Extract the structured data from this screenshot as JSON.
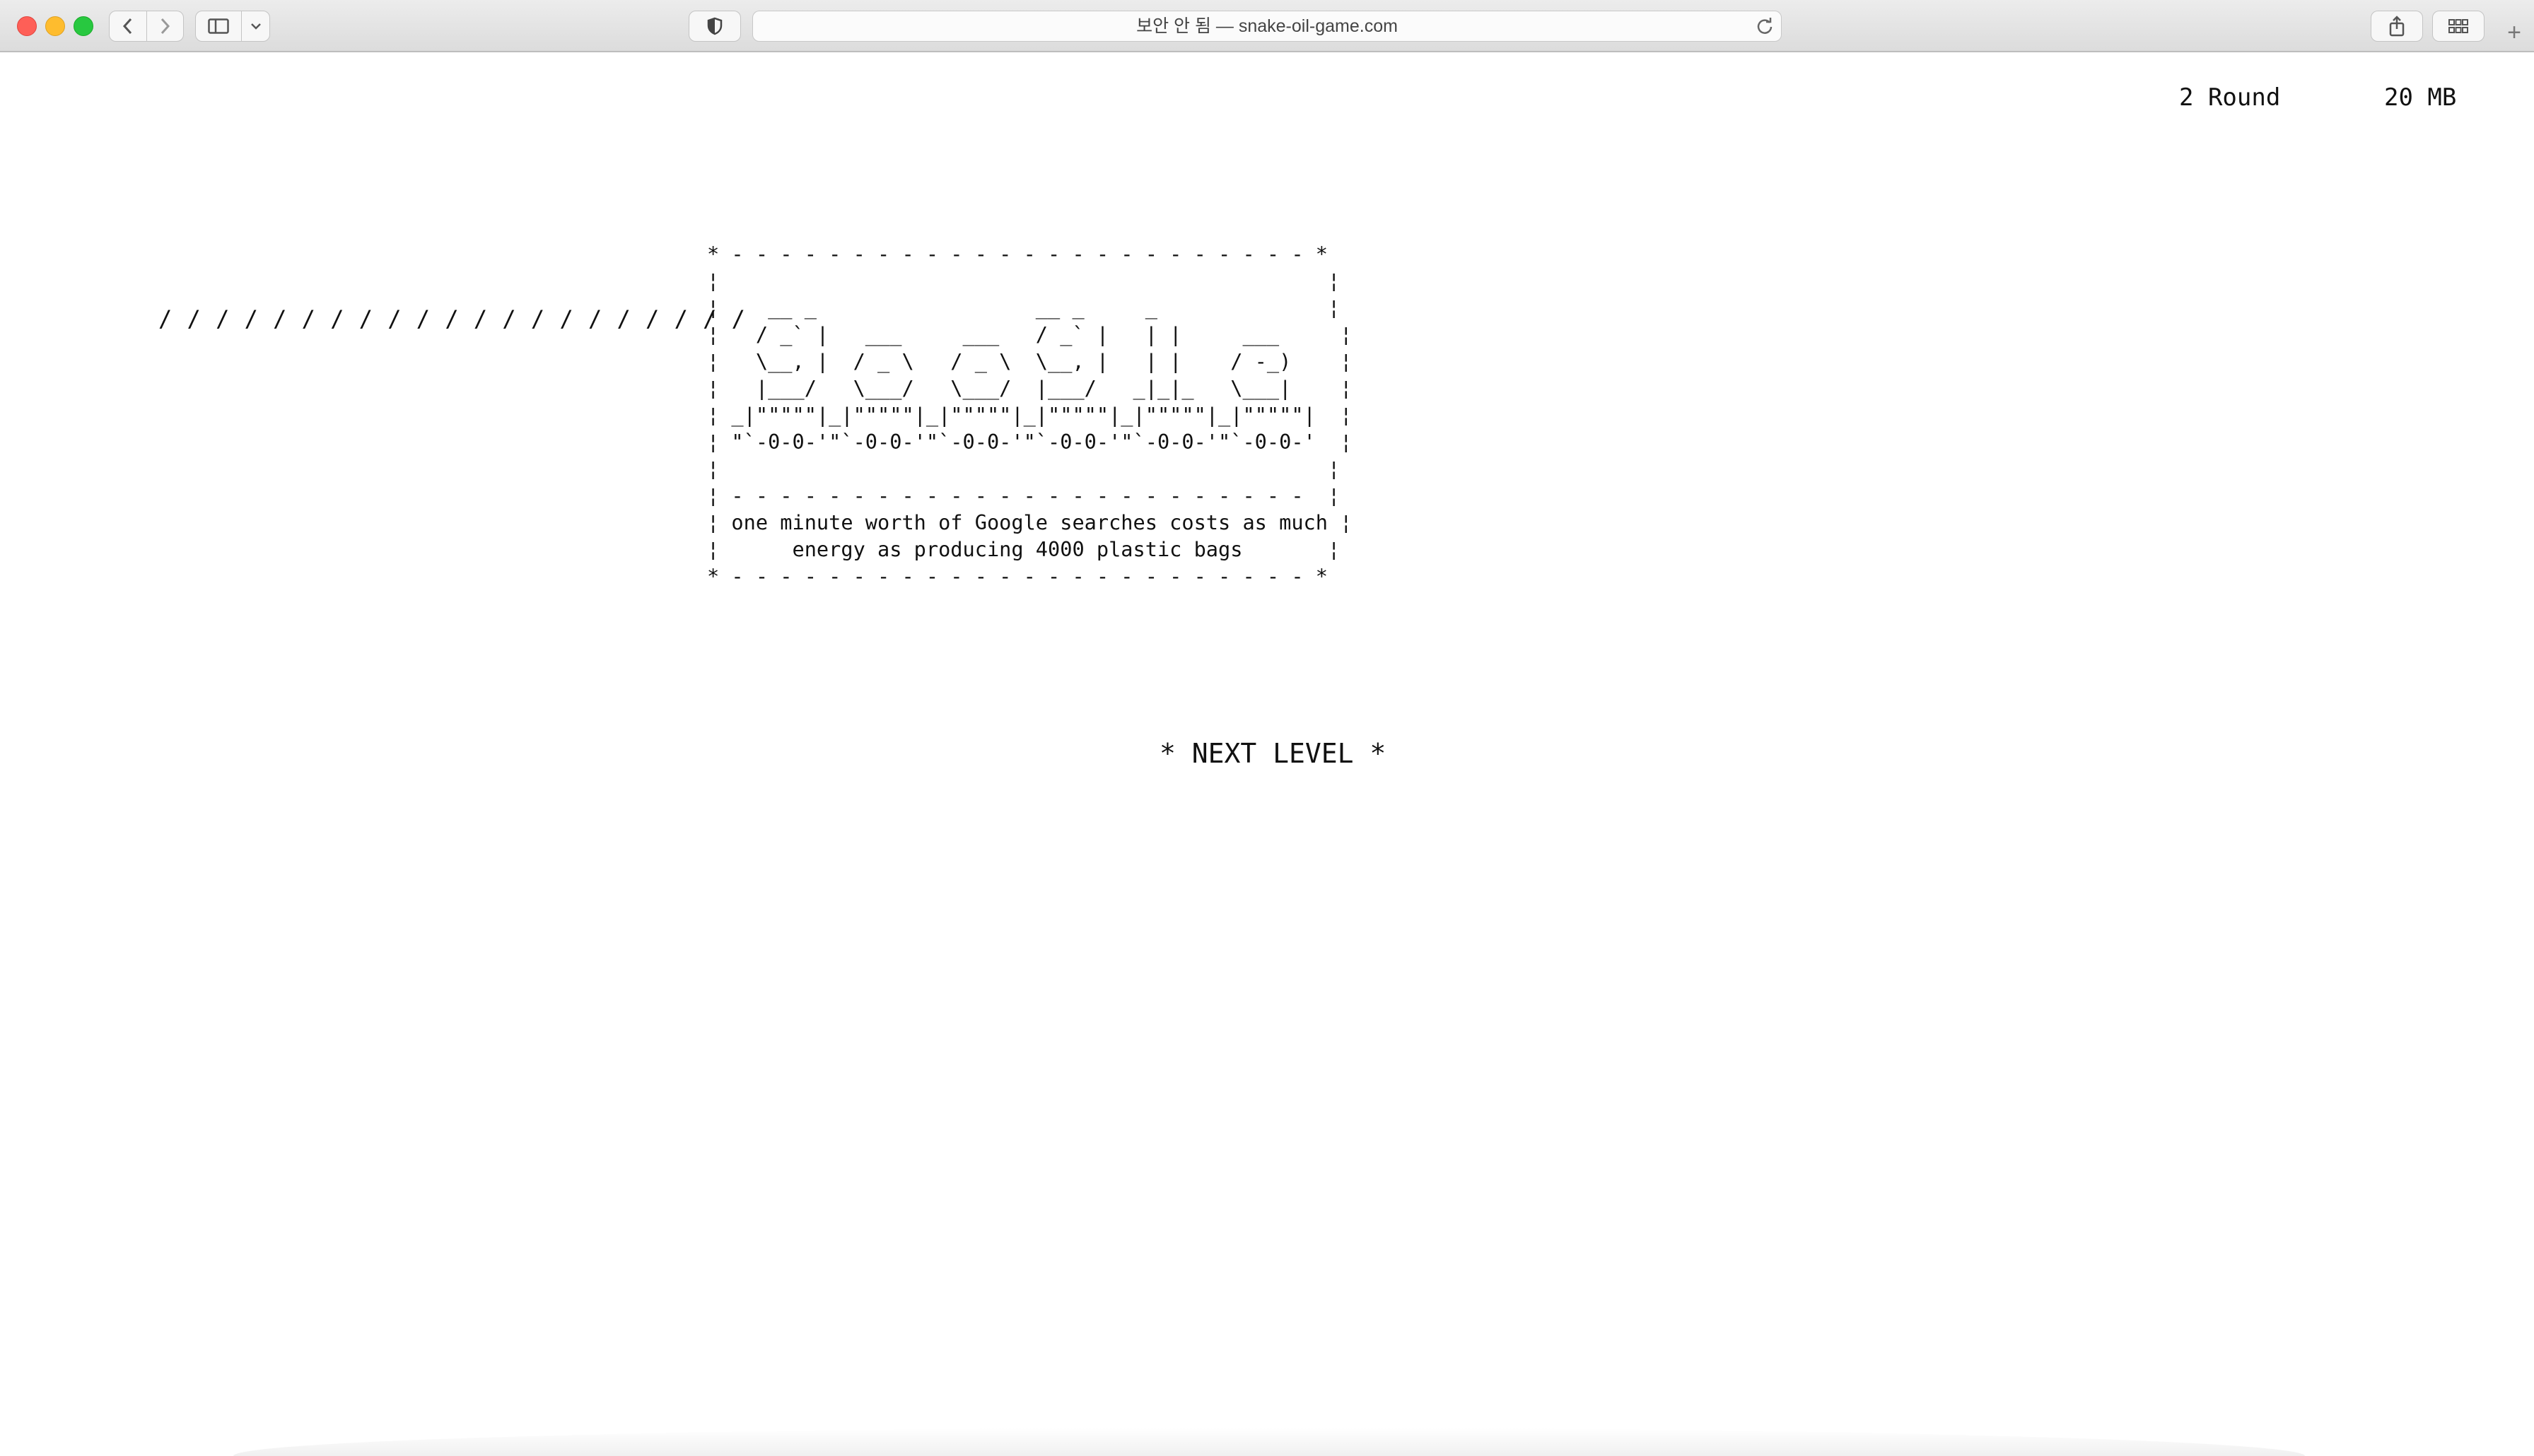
{
  "browser": {
    "url_display": "보안 안 됨 — snake-oil-game.com",
    "icons": {
      "back": "chevron-left-icon",
      "forward": "chevron-right-icon",
      "sidebar": "sidebar-icon",
      "sidebar_menu": "chevron-down-icon",
      "privacy": "shield-icon",
      "reload": "reload-icon",
      "share": "share-icon",
      "tabs": "tab-overview-icon",
      "new_tab": "plus-icon"
    },
    "new_tab_glyph": "+"
  },
  "game": {
    "round_label": "2 Round",
    "memory_label": "20 MB",
    "progress_slashes": "/ / / / / / / / / / / / / / / / / / / / /",
    "ascii_art": "* - - - - - - - - - - - - - - - - - - - - - - - - *\n¦                                                  ¦\n¦    __ _                  __ _     _              ¦\n¦   / _` |   ___     ___   / _` |   | |     ___     ¦\n¦   \\__, |  / _ \\   / _ \\  \\__, |   | |    / -_)    ¦\n¦   |___/   \\___/   \\___/  |___/   _|_|_   \\___|    ¦\n¦ _|\"\"\"\"\"|_|\"\"\"\"\"|_|\"\"\"\"\"|_|\"\"\"\"\"|_|\"\"\"\"\"|_|\"\"\"\"\"|  ¦\n¦ \"`-0-0-'\"`-0-0-'\"`-0-0-'\"`-0-0-'\"`-0-0-'\"`-0-0-'  ¦\n¦                                                  ¦\n¦ - - - - - - - - - - - - - - - - - - - - - - - -  ¦\n¦ one minute worth of Google searches costs as much ¦\n¦      energy as producing 4000 plastic bags       ¦\n* - - - - - - - - - - - - - - - - - - - - - - - - *",
    "next_level_label": "* NEXT LEVEL *"
  }
}
